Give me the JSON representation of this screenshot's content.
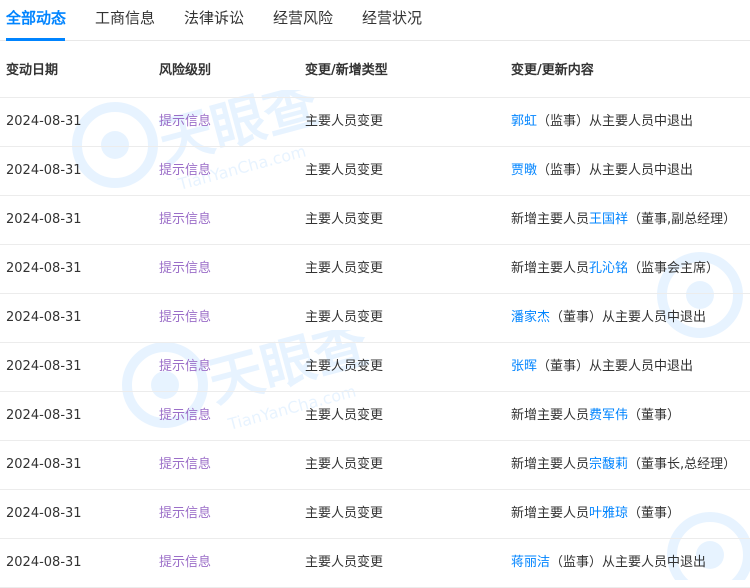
{
  "tabs": [
    {
      "label": "全部动态",
      "active": true
    },
    {
      "label": "工商信息",
      "active": false
    },
    {
      "label": "法律诉讼",
      "active": false
    },
    {
      "label": "经营风险",
      "active": false
    },
    {
      "label": "经营状况",
      "active": false
    }
  ],
  "table": {
    "headers": [
      "变动日期",
      "风险级别",
      "变更/新增类型",
      "变更/更新内容"
    ],
    "rows": [
      {
        "date": "2024-08-31",
        "risk": "提示信息",
        "type": "主要人员变更",
        "prefix": "",
        "person": "郭虹",
        "suffix": "（监事）从主要人员中退出"
      },
      {
        "date": "2024-08-31",
        "risk": "提示信息",
        "type": "主要人员变更",
        "prefix": "",
        "person": "贾暾",
        "suffix": "（监事）从主要人员中退出"
      },
      {
        "date": "2024-08-31",
        "risk": "提示信息",
        "type": "主要人员变更",
        "prefix": "新增主要人员",
        "person": "王国祥",
        "suffix": "（董事,副总经理）"
      },
      {
        "date": "2024-08-31",
        "risk": "提示信息",
        "type": "主要人员变更",
        "prefix": "新增主要人员",
        "person": "孔沁铭",
        "suffix": "（监事会主席）"
      },
      {
        "date": "2024-08-31",
        "risk": "提示信息",
        "type": "主要人员变更",
        "prefix": "",
        "person": "潘家杰",
        "suffix": "（董事）从主要人员中退出"
      },
      {
        "date": "2024-08-31",
        "risk": "提示信息",
        "type": "主要人员变更",
        "prefix": "",
        "person": "张晖",
        "suffix": "（董事）从主要人员中退出"
      },
      {
        "date": "2024-08-31",
        "risk": "提示信息",
        "type": "主要人员变更",
        "prefix": "新增主要人员",
        "person": "费军伟",
        "suffix": "（董事）"
      },
      {
        "date": "2024-08-31",
        "risk": "提示信息",
        "type": "主要人员变更",
        "prefix": "新增主要人员",
        "person": "宗馥莉",
        "suffix": "（董事长,总经理）"
      },
      {
        "date": "2024-08-31",
        "risk": "提示信息",
        "type": "主要人员变更",
        "prefix": "新增主要人员",
        "person": "叶雅琼",
        "suffix": "（董事）"
      },
      {
        "date": "2024-08-31",
        "risk": "提示信息",
        "type": "主要人员变更",
        "prefix": "",
        "person": "蒋丽洁",
        "suffix": "（监事）从主要人员中退出"
      }
    ]
  },
  "watermark": {
    "cn": "天眼查",
    "en": "TianYanCha.com"
  },
  "colors": {
    "accent": "#0084ff",
    "risk": "#9b6ec8",
    "text": "#333333"
  }
}
